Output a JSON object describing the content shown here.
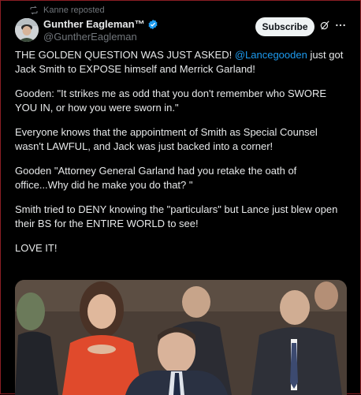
{
  "repost": {
    "label": "Kanne reposted",
    "icon": "repost-icon"
  },
  "author": {
    "display_name": "Gunther Eagleman™",
    "handle": "@GuntherEagleman",
    "verified": true,
    "avatar": "avatar-image"
  },
  "actions": {
    "subscribe_label": "Subscribe",
    "grok_icon": "grok-icon",
    "more_icon": "more-icon"
  },
  "post": {
    "p1_before": "THE GOLDEN QUESTION WAS JUST ASKED! ",
    "p1_mention": "@Lancegooden",
    "p1_after": " just got Jack Smith to EXPOSE himself and Merrick Garland!",
    "p2": "Gooden: \"It strikes me as odd that you don't remember who SWORE YOU IN, or how you were sworn in.\"",
    "p3": "Everyone knows that the appointment of Smith as Special Counsel wasn't LAWFUL, and Jack was just backed into a corner!",
    "p4": "Gooden \"Attorney General Garland had you retake the oath of office...Why did he make you do that? \"",
    "p5": "Smith tried to DENY knowing the \"particulars\" but Lance just blew open their BS for the ENTIRE WORLD to see!",
    "p6": "LOVE IT!"
  },
  "media": {
    "kind": "photo",
    "description_icon": "hearing-photo"
  },
  "colors": {
    "background": "#000000",
    "text": "#e7e9ea",
    "muted": "#71767b",
    "link": "#1d9bf0",
    "button_bg": "#eff3f4"
  }
}
